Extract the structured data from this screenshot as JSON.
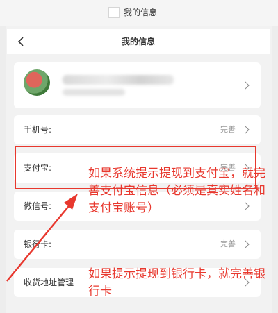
{
  "browser_tab": {
    "title": "我的信息"
  },
  "navbar": {
    "title": "我的信息"
  },
  "rows": [
    {
      "label": "手机号:",
      "status": "完善"
    },
    {
      "label": "支付宝:",
      "status": "完善"
    },
    {
      "label": "微信号:",
      "status": ""
    },
    {
      "label": "银行卡:",
      "status": "完善"
    },
    {
      "label": "收货地址管理",
      "status": ""
    }
  ],
  "annotations": {
    "note_1": "如果系统提示提现到支付宝，就完善支付宝信息（必须是真实姓名和支付宝账号）",
    "note_2": "如果提示提现到银行卡，就完善银行卡",
    "color": "#e8382e"
  },
  "icons": {
    "back": "chevron-left-icon",
    "row": "chevron-right-icon"
  }
}
